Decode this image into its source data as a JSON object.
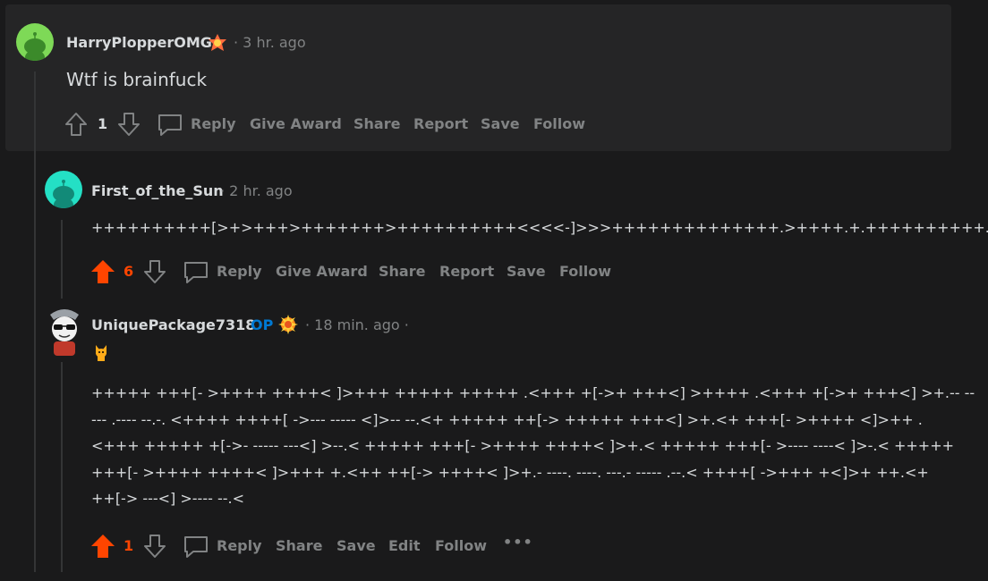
{
  "colors": {
    "upvoted": "#ff4500",
    "op": "#0079d3",
    "muted": "#818384",
    "text": "#d7dadc"
  },
  "comments": [
    {
      "username": "HarryPlopperOMG",
      "time": "· 3 hr. ago",
      "body": "Wtf is brainfuck",
      "votes": "1",
      "actions": {
        "reply": "Reply",
        "award": "Give Award",
        "share": "Share",
        "report": "Report",
        "save": "Save",
        "follow": "Follow"
      }
    },
    {
      "username": "First_of_the_Sun",
      "time": "· 2 hr. ago",
      "body": "++++++++++[>+>+++>+++++++>++++++++++<<<<-]>>>++++++++++++++.>++++.+.++++++++++.",
      "votes": "6",
      "actions": {
        "reply": "Reply",
        "award": "Give Award",
        "share": "Share",
        "report": "Report",
        "save": "Save",
        "follow": "Follow"
      }
    },
    {
      "username": "UniquePackage7318",
      "op": "OP",
      "time": "· 18 min. ago ·",
      "body_lines": [
        "+++++ +++[- >++++ ++++< ]>+++ +++++ +++++ .<+++ +[->+ +++<] >++++ .<+++ +[->+ +++<] >+.-- --",
        "--- .---- --.-. <++++ ++++[ ->--- ----- <]>-- --.<+ +++++ ++[-> +++++ +++<] >+.<+ +++[- >++++ <]>++ .",
        "<+++ +++++ +[->- ----- ---<] >--.< +++++ +++[- >++++ ++++< ]>+.< +++++ +++[- >---- ----< ]>-.< +++++",
        "+++[- >++++ ++++< ]>+++ +.<++ ++[-> ++++< ]>+.- ----. ----. ---.- ----- .--.< ++++[ ->+++ +<]>+ ++.<+",
        "++[-> ---<] >---- --.<"
      ],
      "votes": "1",
      "actions": {
        "reply": "Reply",
        "share": "Share",
        "save": "Save",
        "edit": "Edit",
        "follow": "Follow",
        "more": "•••"
      }
    }
  ]
}
